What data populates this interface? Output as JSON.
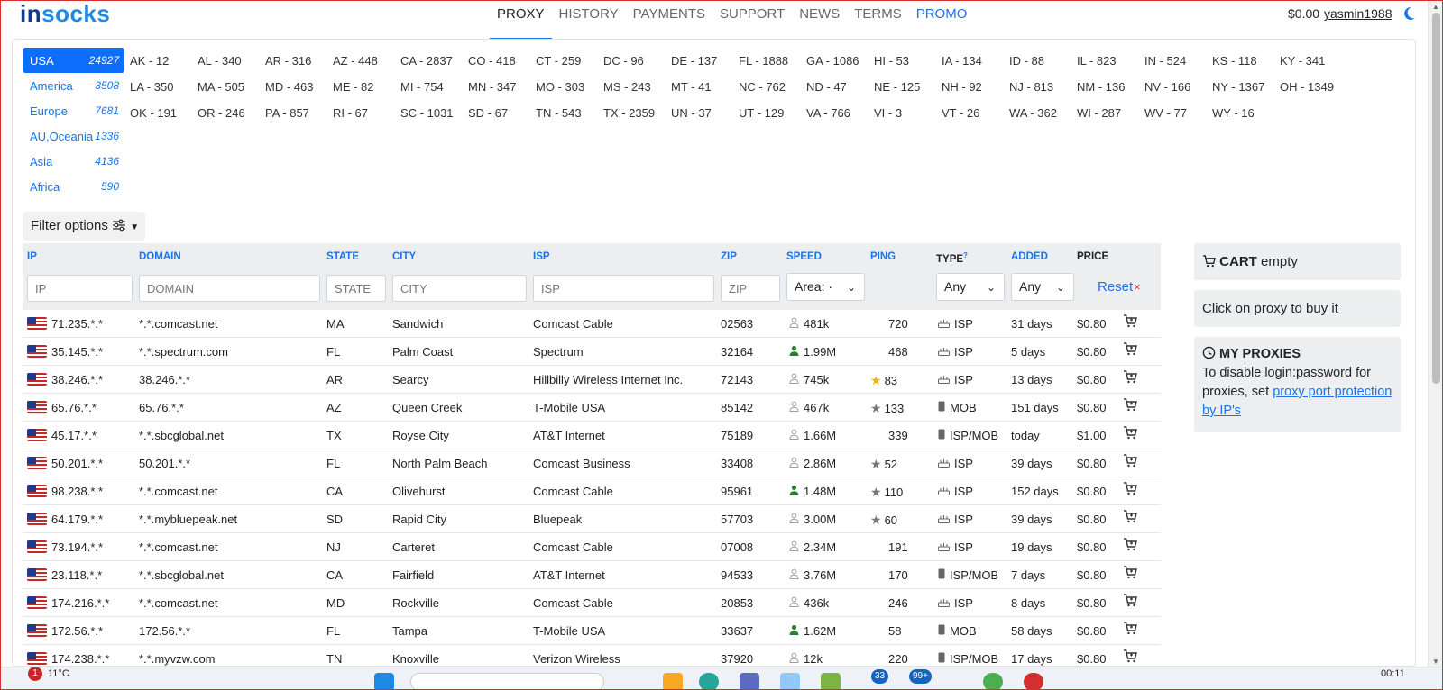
{
  "header": {
    "logo_in": "in",
    "logo_socks": "socks",
    "nav": [
      {
        "label": "PROXY",
        "active": true
      },
      {
        "label": "HISTORY"
      },
      {
        "label": "PAYMENTS"
      },
      {
        "label": "SUPPORT"
      },
      {
        "label": "NEWS"
      },
      {
        "label": "TERMS"
      },
      {
        "label": "PROMO",
        "promo": true
      }
    ],
    "balance": "$0.00",
    "username": "yasmin1988",
    "theme_icon": "moon-icon"
  },
  "regions": [
    {
      "label": "USA",
      "count": "24927",
      "active": true
    },
    {
      "label": "America",
      "count": "3508"
    },
    {
      "label": "Europe",
      "count": "7681"
    },
    {
      "label": "AU,Oceania",
      "count": "1336"
    },
    {
      "label": "Asia",
      "count": "4136"
    },
    {
      "label": "Africa",
      "count": "590"
    }
  ],
  "states": [
    "AK - 12",
    "AL - 340",
    "AR - 316",
    "AZ - 448",
    "CA - 2837",
    "CO - 418",
    "CT - 259",
    "DC - 96",
    "DE - 137",
    "FL - 1888",
    "GA - 1086",
    "HI - 53",
    "IA - 134",
    "ID - 88",
    "IL - 823",
    "IN - 524",
    "KS - 118",
    "KY - 341",
    "LA - 350",
    "MA - 505",
    "MD - 463",
    "ME - 82",
    "MI - 754",
    "MN - 347",
    "MO - 303",
    "MS - 243",
    "MT - 41",
    "NC - 762",
    "ND - 47",
    "NE - 125",
    "NH - 92",
    "NJ - 813",
    "NM - 136",
    "NV - 166",
    "NY - 1367",
    "OH - 1349",
    "OK - 191",
    "OR - 246",
    "PA - 857",
    "RI - 67",
    "SC - 1031",
    "SD - 67",
    "TN - 543",
    "TX - 2359",
    "UN - 37",
    "UT - 129",
    "VA - 766",
    "VI - 3",
    "VT - 26",
    "WA - 362",
    "WI - 287",
    "WV - 77",
    "WY - 16"
  ],
  "filter_label": "Filter options",
  "table": {
    "headers": {
      "ip": "IP",
      "domain": "DOMAIN",
      "state": "STATE",
      "city": "CITY",
      "isp": "ISP",
      "zip": "ZIP",
      "speed": "SPEED",
      "ping": "PING",
      "type": "TYPE",
      "type_sup": "?",
      "added": "ADDED",
      "price": "PRICE"
    },
    "placeholders": {
      "ip": "IP",
      "domain": "DOMAIN",
      "state": "STATE",
      "city": "CITY",
      "isp": "ISP",
      "zip": "ZIP"
    },
    "selects": {
      "speed": "Area: ·",
      "type": "Any",
      "added": "Any"
    },
    "reset": "Reset",
    "reset_x": "×",
    "rows": [
      {
        "ip": "71.235.*.*",
        "domain": "*.*.comcast.net",
        "state": "MA",
        "city": "Sandwich",
        "isp": "Comcast Cable",
        "zip": "02563",
        "speed": "481k",
        "speed_icon": "hollow",
        "ping": "720",
        "star": "",
        "type": "ISP",
        "type_icon": "router-icon",
        "added": "31 days",
        "price": "$0.80"
      },
      {
        "ip": "35.145.*.*",
        "domain": "*.*.spectrum.com",
        "state": "FL",
        "city": "Palm Coast",
        "isp": "Spectrum",
        "zip": "32164",
        "speed": "1.99M",
        "speed_icon": "solid",
        "ping": "468",
        "star": "",
        "type": "ISP",
        "type_icon": "router-icon",
        "added": "5 days",
        "price": "$0.80"
      },
      {
        "ip": "38.246.*.*",
        "domain": "38.246.*.*",
        "state": "AR",
        "city": "Searcy",
        "isp": "Hillbilly Wireless Internet Inc.",
        "zip": "72143",
        "speed": "745k",
        "speed_icon": "hollow",
        "ping": "83",
        "star": "gold",
        "type": "ISP",
        "type_icon": "router-icon",
        "added": "13 days",
        "price": "$0.80"
      },
      {
        "ip": "65.76.*.*",
        "domain": "65.76.*.*",
        "state": "AZ",
        "city": "Queen Creek",
        "isp": "T-Mobile USA",
        "zip": "85142",
        "speed": "467k",
        "speed_icon": "hollow",
        "ping": "133",
        "star": "gray",
        "type": "MOB",
        "type_icon": "phone-icon",
        "added": "151 days",
        "price": "$0.80"
      },
      {
        "ip": "45.17.*.*",
        "domain": "*.*.sbcglobal.net",
        "state": "TX",
        "city": "Royse City",
        "isp": "AT&T Internet",
        "zip": "75189",
        "speed": "1.66M",
        "speed_icon": "hollow",
        "ping": "339",
        "star": "",
        "type": "ISP/MOB",
        "type_icon": "phone-icon",
        "added": "today",
        "price": "$1.00"
      },
      {
        "ip": "50.201.*.*",
        "domain": "50.201.*.*",
        "state": "FL",
        "city": "North Palm Beach",
        "isp": "Comcast Business",
        "zip": "33408",
        "speed": "2.86M",
        "speed_icon": "hollow",
        "ping": "52",
        "star": "gray",
        "type": "ISP",
        "type_icon": "router-icon",
        "added": "39 days",
        "price": "$0.80"
      },
      {
        "ip": "98.238.*.*",
        "domain": "*.*.comcast.net",
        "state": "CA",
        "city": "Olivehurst",
        "isp": "Comcast Cable",
        "zip": "95961",
        "speed": "1.48M",
        "speed_icon": "solid",
        "ping": "110",
        "star": "gray",
        "type": "ISP",
        "type_icon": "router-icon",
        "added": "152 days",
        "price": "$0.80"
      },
      {
        "ip": "64.179.*.*",
        "domain": "*.*.mybluepeak.net",
        "state": "SD",
        "city": "Rapid City",
        "isp": "Bluepeak",
        "zip": "57703",
        "speed": "3.00M",
        "speed_icon": "hollow",
        "ping": "60",
        "star": "gray",
        "type": "ISP",
        "type_icon": "router-icon",
        "added": "39 days",
        "price": "$0.80"
      },
      {
        "ip": "73.194.*.*",
        "domain": "*.*.comcast.net",
        "state": "NJ",
        "city": "Carteret",
        "isp": "Comcast Cable",
        "zip": "07008",
        "speed": "2.34M",
        "speed_icon": "hollow",
        "ping": "191",
        "star": "",
        "type": "ISP",
        "type_icon": "router-icon",
        "added": "19 days",
        "price": "$0.80"
      },
      {
        "ip": "23.118.*.*",
        "domain": "*.*.sbcglobal.net",
        "state": "CA",
        "city": "Fairfield",
        "isp": "AT&T Internet",
        "zip": "94533",
        "speed": "3.76M",
        "speed_icon": "hollow",
        "ping": "170",
        "star": "",
        "type": "ISP/MOB",
        "type_icon": "phone-icon",
        "added": "7 days",
        "price": "$0.80"
      },
      {
        "ip": "174.216.*.*",
        "domain": "*.*.comcast.net",
        "state": "MD",
        "city": "Rockville",
        "isp": "Comcast Cable",
        "zip": "20853",
        "speed": "436k",
        "speed_icon": "hollow",
        "ping": "246",
        "star": "",
        "type": "ISP",
        "type_icon": "router-icon",
        "added": "8 days",
        "price": "$0.80"
      },
      {
        "ip": "172.56.*.*",
        "domain": "172.56.*.*",
        "state": "FL",
        "city": "Tampa",
        "isp": "T-Mobile USA",
        "zip": "33637",
        "speed": "1.62M",
        "speed_icon": "solid",
        "ping": "58",
        "star": "",
        "type": "MOB",
        "type_icon": "phone-icon",
        "added": "58 days",
        "price": "$0.80"
      },
      {
        "ip": "174.238.*.*",
        "domain": "*.*.myvzw.com",
        "state": "TN",
        "city": "Knoxville",
        "isp": "Verizon Wireless",
        "zip": "37920",
        "speed": "12k",
        "speed_icon": "hollow",
        "ping": "220",
        "star": "",
        "type": "ISP/MOB",
        "type_icon": "phone-icon",
        "added": "17 days",
        "price": "$0.80"
      }
    ]
  },
  "cart": {
    "title": "CART",
    "status": "empty"
  },
  "click_hint": "Click on proxy to buy it",
  "my_proxies": {
    "title": "MY PROXIES",
    "text": "To disable login:password for proxies, set",
    "link": "proxy port protection by IP's"
  },
  "taskbar": {
    "notif": "1",
    "weather": "11°C",
    "badge1": "33",
    "badge2": "99+",
    "clock": "00:11"
  }
}
